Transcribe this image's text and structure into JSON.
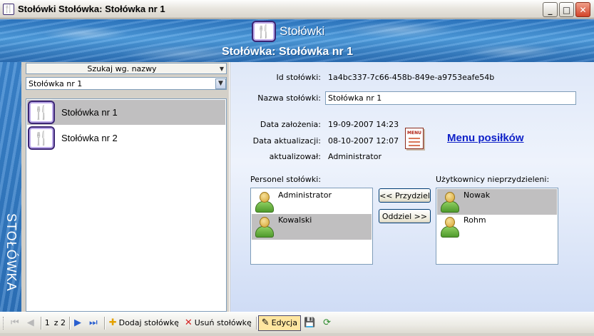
{
  "window": {
    "title": "Stołówki  Stołówka: Stołówka nr 1",
    "minimize_glyph": "_",
    "maximize_glyph": "□",
    "close_glyph": "✕"
  },
  "header": {
    "app_name": "Stołówki",
    "subtitle": "Stołówka: Stołówka nr 1"
  },
  "sideband": {
    "label": "STOŁÓWKA"
  },
  "left": {
    "search_mode": "Szukaj wg. nazwy",
    "selected_value": "Stołówka nr 1",
    "items": [
      {
        "label": "Stołówka nr 1",
        "selected": true
      },
      {
        "label": "Stołówka nr 2",
        "selected": false
      }
    ]
  },
  "details": {
    "id_label": "Id stołówki:",
    "id_value": "1a4bc337-7c66-458b-849e-a9753eafe54b",
    "name_label": "Nazwa stołówki:",
    "name_value": "Stołówka nr 1",
    "created_label": "Data założenia:",
    "created_value": "19-09-2007 14:23",
    "updated_label": "Data aktualizacji:",
    "updated_value": "08-10-2007 12:07",
    "updated_by_label": "aktualizował:",
    "updated_by_value": "Administrator",
    "menu_link": "Menu posiłków",
    "menu_doc_header": "MENU"
  },
  "staff": {
    "label": "Personel stołówki:",
    "people": [
      {
        "name": "Administrator",
        "selected": false
      },
      {
        "name": "Kowalski",
        "selected": true
      }
    ]
  },
  "unassigned": {
    "label": "Użytkownicy nieprzydzieleni:",
    "people": [
      {
        "name": "Nowak",
        "selected": true
      },
      {
        "name": "Rohm",
        "selected": false
      }
    ]
  },
  "actions": {
    "assign": "<< Przydziel",
    "detach": "Oddziel >>"
  },
  "toolbar": {
    "page_current": "1",
    "page_of": "z 2",
    "add_label": "Dodaj stołówkę",
    "delete_label": "Usuń stołówkę",
    "edit_label": "Edycja",
    "icons": [
      "first-icon",
      "prev-icon",
      "next-icon",
      "last-icon",
      "add-icon",
      "delete-icon",
      "edit-icon",
      "save-icon",
      "refresh-icon"
    ]
  }
}
